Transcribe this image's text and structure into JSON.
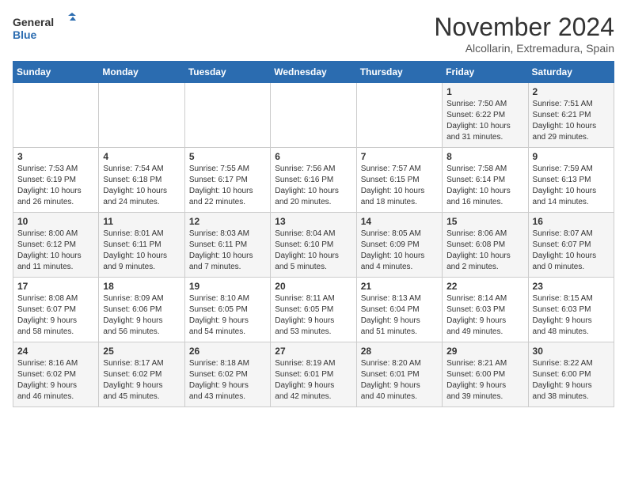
{
  "header": {
    "logo_line1": "General",
    "logo_line2": "Blue",
    "month": "November 2024",
    "location": "Alcollarin, Extremadura, Spain"
  },
  "days_of_week": [
    "Sunday",
    "Monday",
    "Tuesday",
    "Wednesday",
    "Thursday",
    "Friday",
    "Saturday"
  ],
  "weeks": [
    [
      {
        "day": "",
        "info": ""
      },
      {
        "day": "",
        "info": ""
      },
      {
        "day": "",
        "info": ""
      },
      {
        "day": "",
        "info": ""
      },
      {
        "day": "",
        "info": ""
      },
      {
        "day": "1",
        "info": "Sunrise: 7:50 AM\nSunset: 6:22 PM\nDaylight: 10 hours\nand 31 minutes."
      },
      {
        "day": "2",
        "info": "Sunrise: 7:51 AM\nSunset: 6:21 PM\nDaylight: 10 hours\nand 29 minutes."
      }
    ],
    [
      {
        "day": "3",
        "info": "Sunrise: 7:53 AM\nSunset: 6:19 PM\nDaylight: 10 hours\nand 26 minutes."
      },
      {
        "day": "4",
        "info": "Sunrise: 7:54 AM\nSunset: 6:18 PM\nDaylight: 10 hours\nand 24 minutes."
      },
      {
        "day": "5",
        "info": "Sunrise: 7:55 AM\nSunset: 6:17 PM\nDaylight: 10 hours\nand 22 minutes."
      },
      {
        "day": "6",
        "info": "Sunrise: 7:56 AM\nSunset: 6:16 PM\nDaylight: 10 hours\nand 20 minutes."
      },
      {
        "day": "7",
        "info": "Sunrise: 7:57 AM\nSunset: 6:15 PM\nDaylight: 10 hours\nand 18 minutes."
      },
      {
        "day": "8",
        "info": "Sunrise: 7:58 AM\nSunset: 6:14 PM\nDaylight: 10 hours\nand 16 minutes."
      },
      {
        "day": "9",
        "info": "Sunrise: 7:59 AM\nSunset: 6:13 PM\nDaylight: 10 hours\nand 14 minutes."
      }
    ],
    [
      {
        "day": "10",
        "info": "Sunrise: 8:00 AM\nSunset: 6:12 PM\nDaylight: 10 hours\nand 11 minutes."
      },
      {
        "day": "11",
        "info": "Sunrise: 8:01 AM\nSunset: 6:11 PM\nDaylight: 10 hours\nand 9 minutes."
      },
      {
        "day": "12",
        "info": "Sunrise: 8:03 AM\nSunset: 6:11 PM\nDaylight: 10 hours\nand 7 minutes."
      },
      {
        "day": "13",
        "info": "Sunrise: 8:04 AM\nSunset: 6:10 PM\nDaylight: 10 hours\nand 5 minutes."
      },
      {
        "day": "14",
        "info": "Sunrise: 8:05 AM\nSunset: 6:09 PM\nDaylight: 10 hours\nand 4 minutes."
      },
      {
        "day": "15",
        "info": "Sunrise: 8:06 AM\nSunset: 6:08 PM\nDaylight: 10 hours\nand 2 minutes."
      },
      {
        "day": "16",
        "info": "Sunrise: 8:07 AM\nSunset: 6:07 PM\nDaylight: 10 hours\nand 0 minutes."
      }
    ],
    [
      {
        "day": "17",
        "info": "Sunrise: 8:08 AM\nSunset: 6:07 PM\nDaylight: 9 hours\nand 58 minutes."
      },
      {
        "day": "18",
        "info": "Sunrise: 8:09 AM\nSunset: 6:06 PM\nDaylight: 9 hours\nand 56 minutes."
      },
      {
        "day": "19",
        "info": "Sunrise: 8:10 AM\nSunset: 6:05 PM\nDaylight: 9 hours\nand 54 minutes."
      },
      {
        "day": "20",
        "info": "Sunrise: 8:11 AM\nSunset: 6:05 PM\nDaylight: 9 hours\nand 53 minutes."
      },
      {
        "day": "21",
        "info": "Sunrise: 8:13 AM\nSunset: 6:04 PM\nDaylight: 9 hours\nand 51 minutes."
      },
      {
        "day": "22",
        "info": "Sunrise: 8:14 AM\nSunset: 6:03 PM\nDaylight: 9 hours\nand 49 minutes."
      },
      {
        "day": "23",
        "info": "Sunrise: 8:15 AM\nSunset: 6:03 PM\nDaylight: 9 hours\nand 48 minutes."
      }
    ],
    [
      {
        "day": "24",
        "info": "Sunrise: 8:16 AM\nSunset: 6:02 PM\nDaylight: 9 hours\nand 46 minutes."
      },
      {
        "day": "25",
        "info": "Sunrise: 8:17 AM\nSunset: 6:02 PM\nDaylight: 9 hours\nand 45 minutes."
      },
      {
        "day": "26",
        "info": "Sunrise: 8:18 AM\nSunset: 6:02 PM\nDaylight: 9 hours\nand 43 minutes."
      },
      {
        "day": "27",
        "info": "Sunrise: 8:19 AM\nSunset: 6:01 PM\nDaylight: 9 hours\nand 42 minutes."
      },
      {
        "day": "28",
        "info": "Sunrise: 8:20 AM\nSunset: 6:01 PM\nDaylight: 9 hours\nand 40 minutes."
      },
      {
        "day": "29",
        "info": "Sunrise: 8:21 AM\nSunset: 6:00 PM\nDaylight: 9 hours\nand 39 minutes."
      },
      {
        "day": "30",
        "info": "Sunrise: 8:22 AM\nSunset: 6:00 PM\nDaylight: 9 hours\nand 38 minutes."
      }
    ]
  ]
}
